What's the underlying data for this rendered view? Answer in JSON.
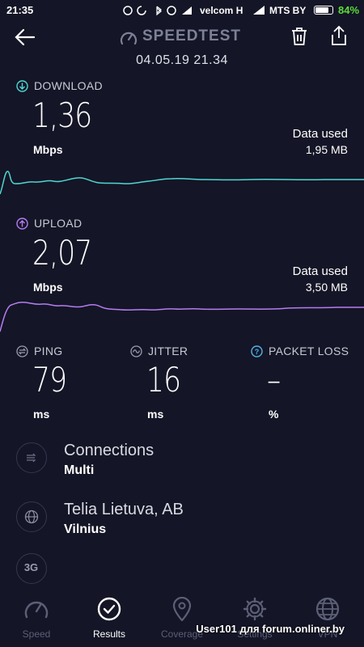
{
  "status_bar": {
    "time": "21:35",
    "carrier1": "velcom H",
    "carrier2": "MTS BY",
    "battery_pct": "84%",
    "battery_level": 0.84
  },
  "header": {
    "title": "SPEEDTEST",
    "date": "04.05.19 21.34"
  },
  "download": {
    "label": "DOWNLOAD",
    "value": "1,36",
    "unit": "Mbps",
    "data_used_label": "Data used",
    "data_used_value": "1,95 MB",
    "color": "#4fd6d3"
  },
  "upload": {
    "label": "UPLOAD",
    "value": "2,07",
    "unit": "Mbps",
    "data_used_label": "Data used",
    "data_used_value": "3,50 MB",
    "color": "#b57cf2"
  },
  "ping": {
    "label": "PING",
    "value": "79",
    "unit": "ms"
  },
  "jitter": {
    "label": "JITTER",
    "value": "16",
    "unit": "ms"
  },
  "packet_loss": {
    "label": "PACKET LOSS",
    "value": "–",
    "unit": "%"
  },
  "details": [
    {
      "title": "Connections",
      "subtitle": "Multi",
      "icon": "connections-icon"
    },
    {
      "title": "Telia Lietuva, AB",
      "subtitle": "Vilnius",
      "icon": "globe-icon"
    },
    {
      "title": "",
      "subtitle": "",
      "icon": "3g-icon",
      "badge": "3G"
    }
  ],
  "nav": [
    {
      "label": "Speed",
      "icon": "gauge-icon",
      "active": false
    },
    {
      "label": "Results",
      "icon": "check-circle-icon",
      "active": true
    },
    {
      "label": "Coverage",
      "icon": "map-pin-icon",
      "active": false
    },
    {
      "label": "Settings",
      "icon": "gear-icon",
      "active": false
    },
    {
      "label": "VPN",
      "icon": "vpn-globe-icon",
      "active": false
    }
  ],
  "watermark": "User101 для forum.onliner.by"
}
